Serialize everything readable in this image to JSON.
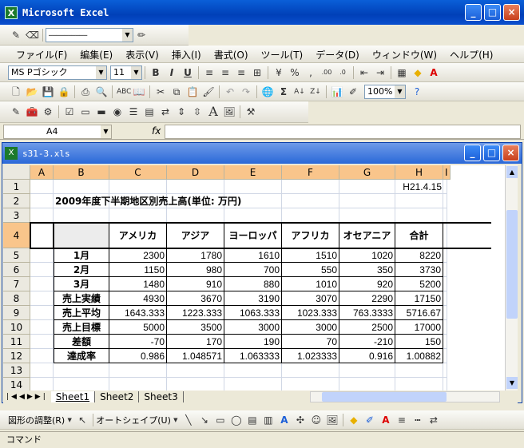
{
  "app": {
    "title": "Microsoft Excel",
    "win_min": "_",
    "win_max": "□",
    "win_close": "×"
  },
  "line_toolbar": {
    "line_style": "──────────"
  },
  "menu": [
    "ファイル(F)",
    "編集(E)",
    "表示(V)",
    "挿入(I)",
    "書式(O)",
    "ツール(T)",
    "データ(D)",
    "ウィンドウ(W)",
    "ヘルプ(H)"
  ],
  "format": {
    "font": "MS Pゴシック",
    "size": "11"
  },
  "standard": {
    "zoom": "100%"
  },
  "formula": {
    "namebox": "A4",
    "fx": "fx",
    "content": ""
  },
  "workbook": {
    "name": "s31-3.xls"
  },
  "columns": [
    "A",
    "B",
    "C",
    "D",
    "E",
    "F",
    "G",
    "H",
    "I"
  ],
  "rows": [
    "1",
    "2",
    "3",
    "4",
    "5",
    "6",
    "7",
    "8",
    "9",
    "10",
    "11",
    "12",
    "13",
    "14"
  ],
  "sheet": {
    "date": "H21.4.15",
    "title": "2009年度下半期地区別売上高(単位: 万円)",
    "headers": [
      "アメリカ",
      "アジア",
      "ヨーロッパ",
      "アフリカ",
      "オセアニア",
      "合計"
    ],
    "data": [
      [
        "1月",
        "2300",
        "1780",
        "1610",
        "1510",
        "1020",
        "8220"
      ],
      [
        "2月",
        "1150",
        "980",
        "700",
        "550",
        "350",
        "3730"
      ],
      [
        "3月",
        "1480",
        "910",
        "880",
        "1010",
        "920",
        "5200"
      ],
      [
        "売上実績",
        "4930",
        "3670",
        "3190",
        "3070",
        "2290",
        "17150"
      ],
      [
        "売上平均",
        "1643.333",
        "1223.333",
        "1063.333",
        "1023.333",
        "763.3333",
        "5716.67"
      ],
      [
        "売上目標",
        "5000",
        "3500",
        "3000",
        "3000",
        "2500",
        "17000"
      ],
      [
        "差額",
        "-70",
        "170",
        "190",
        "70",
        "-210",
        "150"
      ],
      [
        "達成率",
        "0.986",
        "1.048571",
        "1.063333",
        "1.023333",
        "0.916",
        "1.00882"
      ]
    ]
  },
  "tabs": [
    "Sheet1",
    "Sheet2",
    "Sheet3"
  ],
  "drawing": {
    "adjust": "図形の調整(R)",
    "autoshape": "オートシェイプ(U)"
  },
  "status": "コマンド"
}
